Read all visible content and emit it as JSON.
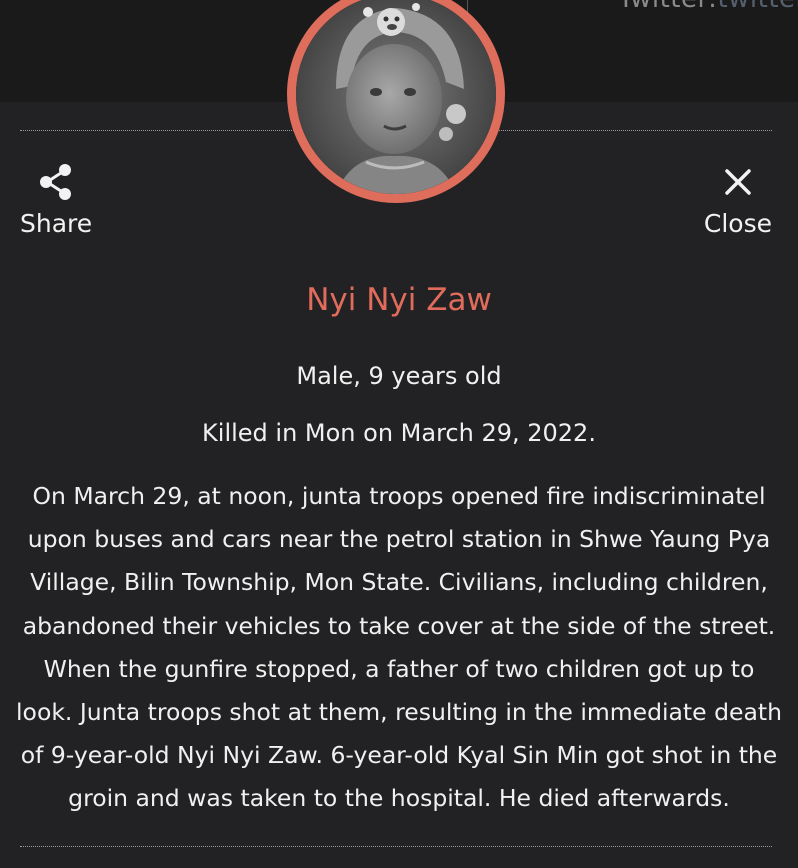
{
  "header": {
    "twitter_label": "Twitter:",
    "twitter_handle": "twitter.c"
  },
  "actions": {
    "share_label": "Share",
    "close_label": "Close"
  },
  "profile": {
    "name": "Nyi Nyi Zaw",
    "gender_age": "Male, 9 years old",
    "killed": "Killed in Mon on March 29, 2022.",
    "story": "On March 29, at noon, junta troops opened fire indiscriminatel upon buses and cars near the petrol station in Shwe Yaung Pya Village, Bilin Township, Mon State. Civilians, including children, abandoned their vehicles to take cover at the side of the street. When the gunfire stopped, a father of two children got up to look. Junta troops shot at them, resulting in the immediate death of 9-year-old Nyi Nyi Zaw. 6-year-old Kyal Sin Min got shot in the groin and was taken to the hospital. He died afterwards."
  },
  "colors": {
    "accent": "#e26c5c",
    "ring": "#df6d5c",
    "background": "#222224",
    "top_band": "#1a1a1b"
  }
}
